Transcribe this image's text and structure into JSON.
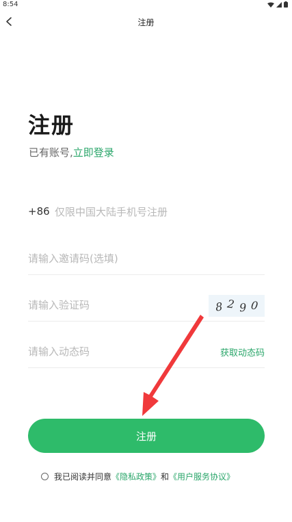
{
  "status_bar": {
    "time": "8:54"
  },
  "nav": {
    "title": "注册"
  },
  "heading": "注册",
  "login_prompt": {
    "text": "已有账号,",
    "link": "立即登录"
  },
  "phone": {
    "prefix": "+86",
    "placeholder": "仅限中国大陆手机号注册",
    "value": ""
  },
  "invite": {
    "placeholder": "请输入邀请码(选填)",
    "value": ""
  },
  "captcha": {
    "placeholder": "请输入验证码",
    "value": "",
    "code_digits": [
      "8",
      "2",
      "9",
      "0"
    ]
  },
  "sms": {
    "placeholder": "请输入动态码",
    "value": "",
    "get_code_label": "获取动态码"
  },
  "register_button": {
    "label": "注册"
  },
  "agreement": {
    "prefix": "我已阅读并同意",
    "privacy": "《隐私政策》",
    "conjunction": "和",
    "terms": "《用户服务协议》",
    "checked": false
  },
  "colors": {
    "accent": "#2ebb6a",
    "link": "#2aa66a",
    "arrow": "#f0393b"
  }
}
